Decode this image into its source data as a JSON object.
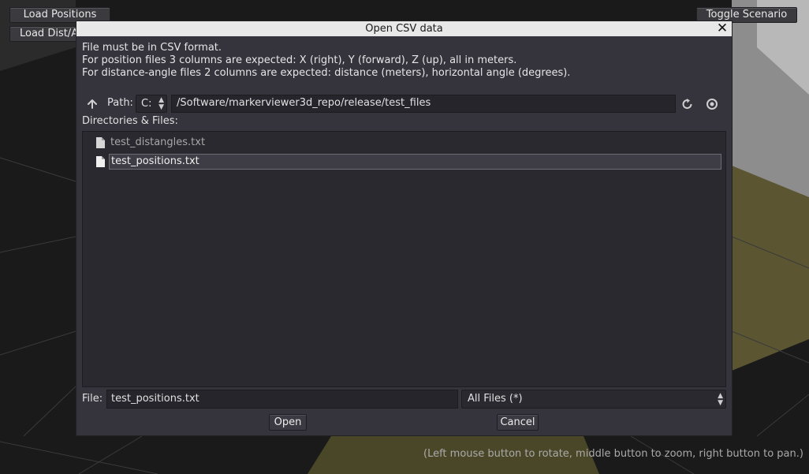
{
  "app": {
    "load_positions_label": "Load Positions",
    "load_dist_label": "Load Dist/A",
    "toggle_scenario_label": "Toggle Scenario",
    "hint": "(Left mouse button to rotate, middle button to zoom, right button to pan.)"
  },
  "dialog": {
    "title": "Open CSV data",
    "close_glyph": "✕",
    "info_lines": [
      "File must be in CSV format.",
      "For position files 3 columns are expected: X (right), Y (forward), Z (up), all in meters.",
      "For distance-angle files 2 columns are expected: distance (meters), horizontal angle (degrees)."
    ],
    "path_label": "Path:",
    "drive": "C:",
    "path": "/Software/markerviewer3d_repo/release/test_files",
    "dir_label": "Directories & Files:",
    "files": [
      "test_distangles.txt",
      "test_positions.txt"
    ],
    "file_label": "File:",
    "file_value": "test_positions.txt",
    "filter": "All Files (*)",
    "open_label": "Open",
    "cancel_label": "Cancel"
  },
  "icons": {
    "up": "up-arrow-icon",
    "refresh": "refresh-icon",
    "hidden_toggle": "eye-icon",
    "file": "file-icon"
  }
}
